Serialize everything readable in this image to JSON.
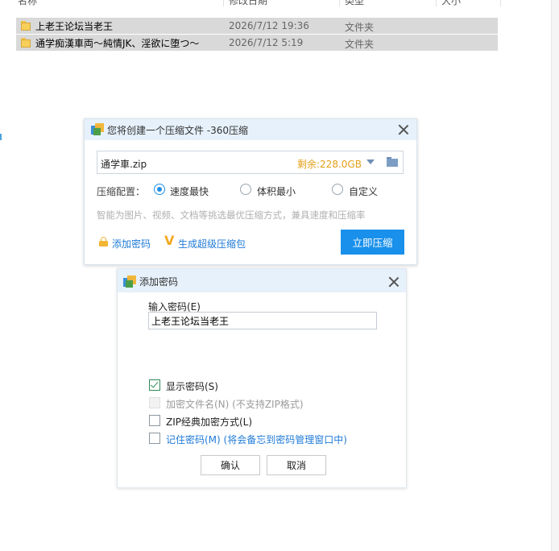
{
  "explorer": {
    "columns": [
      "名称",
      "修改日期",
      "类型",
      "大小"
    ],
    "files": [
      {
        "name": "上老王论坛当老王",
        "date": "2026/7/12 19:36",
        "type": "文件夹"
      },
      {
        "name": "通学痴漢車両～純情JK、淫欲に堕つ～",
        "date": "2026/7/12 5:19",
        "type": "文件夹"
      }
    ]
  },
  "compress_dialog": {
    "title": "您将创建一个压缩文件 -360压缩",
    "filename": "通学車.zip",
    "remaining": "剩余:228.0GB",
    "config_label": "压缩配置：",
    "options": [
      "速度最快",
      "体积最小",
      "自定义"
    ],
    "selected_option": "速度最快",
    "hint": "智能为图片、视频、文档等挑选最优压缩方式，兼具速度和压缩率",
    "add_password": "添加密码",
    "super_package": "生成超级压缩包",
    "compress_now": "立即压缩"
  },
  "password_dialog": {
    "title": "添加密码",
    "input_label": "输入密码(E)",
    "password_value": "上老王论坛当老王",
    "options": [
      {
        "label": "显示密码(S)",
        "checked": true,
        "disabled": false
      },
      {
        "label": "加密文件名(N) (不支持ZIP格式)",
        "checked": false,
        "disabled": true
      },
      {
        "label": "ZIP经典加密方式(L)",
        "checked": false,
        "disabled": false
      },
      {
        "label": "记住密码(M) (将会备忘到密码管理窗口中)",
        "checked": false,
        "disabled": false
      }
    ],
    "ok": "确认",
    "cancel": "取消"
  },
  "colors": {
    "accent": "#1990eb",
    "titlebar": "#e6f1fb",
    "remaining": "#e3a018",
    "selection": "#d9d9d9"
  }
}
